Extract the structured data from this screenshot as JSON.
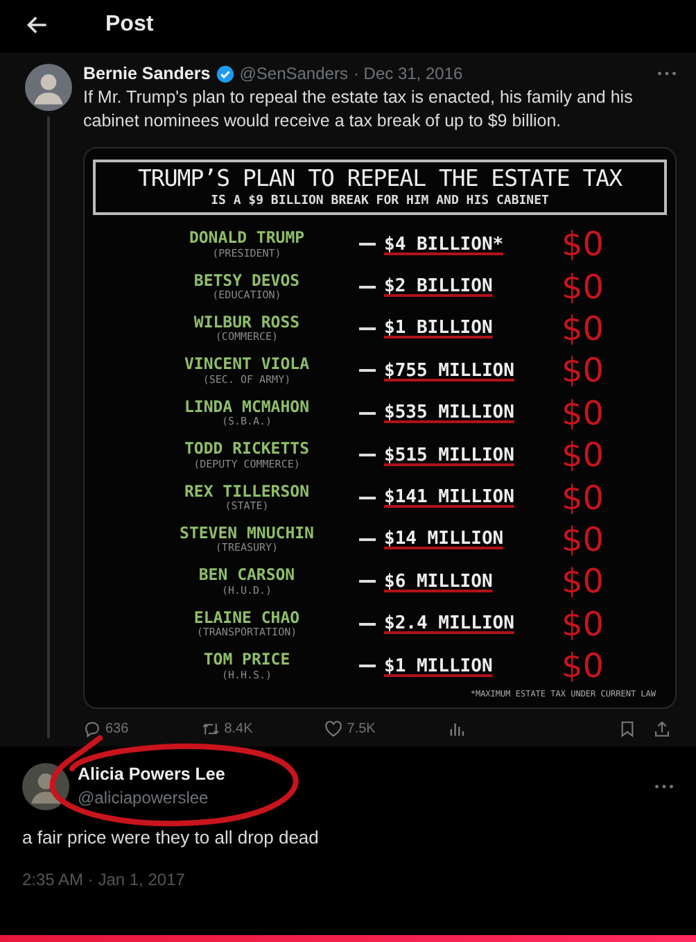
{
  "header": {
    "title": "Post"
  },
  "quoted_post": {
    "author": "Bernie Sanders",
    "verified": true,
    "handle": "@SenSanders",
    "date": "· Dec 31, 2016",
    "text": "If Mr. Trump's plan to repeal the estate tax is enacted, his family and his cabinet nominees would receive a tax break of up to $9 billion.",
    "image": {
      "title": "TRUMP’S PLAN TO REPEAL THE ESTATE TAX",
      "subtitle": "IS A $9 BILLION BREAK FOR HIM AND HIS CABINET",
      "rows": [
        {
          "name": "DONALD TRUMP",
          "role": "(PRESIDENT)",
          "amount": "$4 BILLION*",
          "new": "$0"
        },
        {
          "name": "BETSY DEVOS",
          "role": "(EDUCATION)",
          "amount": "$2 BILLION",
          "new": "$0"
        },
        {
          "name": "WILBUR ROSS",
          "role": "(COMMERCE)",
          "amount": "$1 BILLION",
          "new": "$0"
        },
        {
          "name": "VINCENT VIOLA",
          "role": "(SEC. OF ARMY)",
          "amount": "$755 MILLION",
          "new": "$0"
        },
        {
          "name": "LINDA MCMAHON",
          "role": "(S.B.A.)",
          "amount": "$535 MILLION",
          "new": "$0"
        },
        {
          "name": "TODD RICKETTS",
          "role": "(DEPUTY COMMERCE)",
          "amount": "$515 MILLION",
          "new": "$0"
        },
        {
          "name": "REX TILLERSON",
          "role": "(STATE)",
          "amount": "$141 MILLION",
          "new": "$0"
        },
        {
          "name": "STEVEN MNUCHIN",
          "role": "(TREASURY)",
          "amount": "$14 MILLION",
          "new": "$0"
        },
        {
          "name": "BEN CARSON",
          "role": "(H.U.D.)",
          "amount": "$6 MILLION",
          "new": "$0"
        },
        {
          "name": "ELAINE CHAO",
          "role": "(TRANSPORTATION)",
          "amount": "$2.4 MILLION",
          "new": "$0"
        },
        {
          "name": "TOM PRICE",
          "role": "(H.H.S.)",
          "amount": "$1 MILLION",
          "new": "$0"
        }
      ],
      "footnote": "*MAXIMUM ESTATE TAX UNDER CURRENT LAW"
    },
    "actions": [
      {
        "kind": "reply",
        "count": "636"
      },
      {
        "kind": "repost",
        "count": "8.4K"
      },
      {
        "kind": "like",
        "count": "7.5K"
      },
      {
        "kind": "views"
      },
      {
        "kind": "bookmark"
      },
      {
        "kind": "share"
      }
    ]
  },
  "reply": {
    "author": "Alicia Powers Lee",
    "handle": "@aliciapowerslee",
    "text": "a fair price were they to all drop dead",
    "time": "2:35 AM · Jan 1, 2017"
  }
}
